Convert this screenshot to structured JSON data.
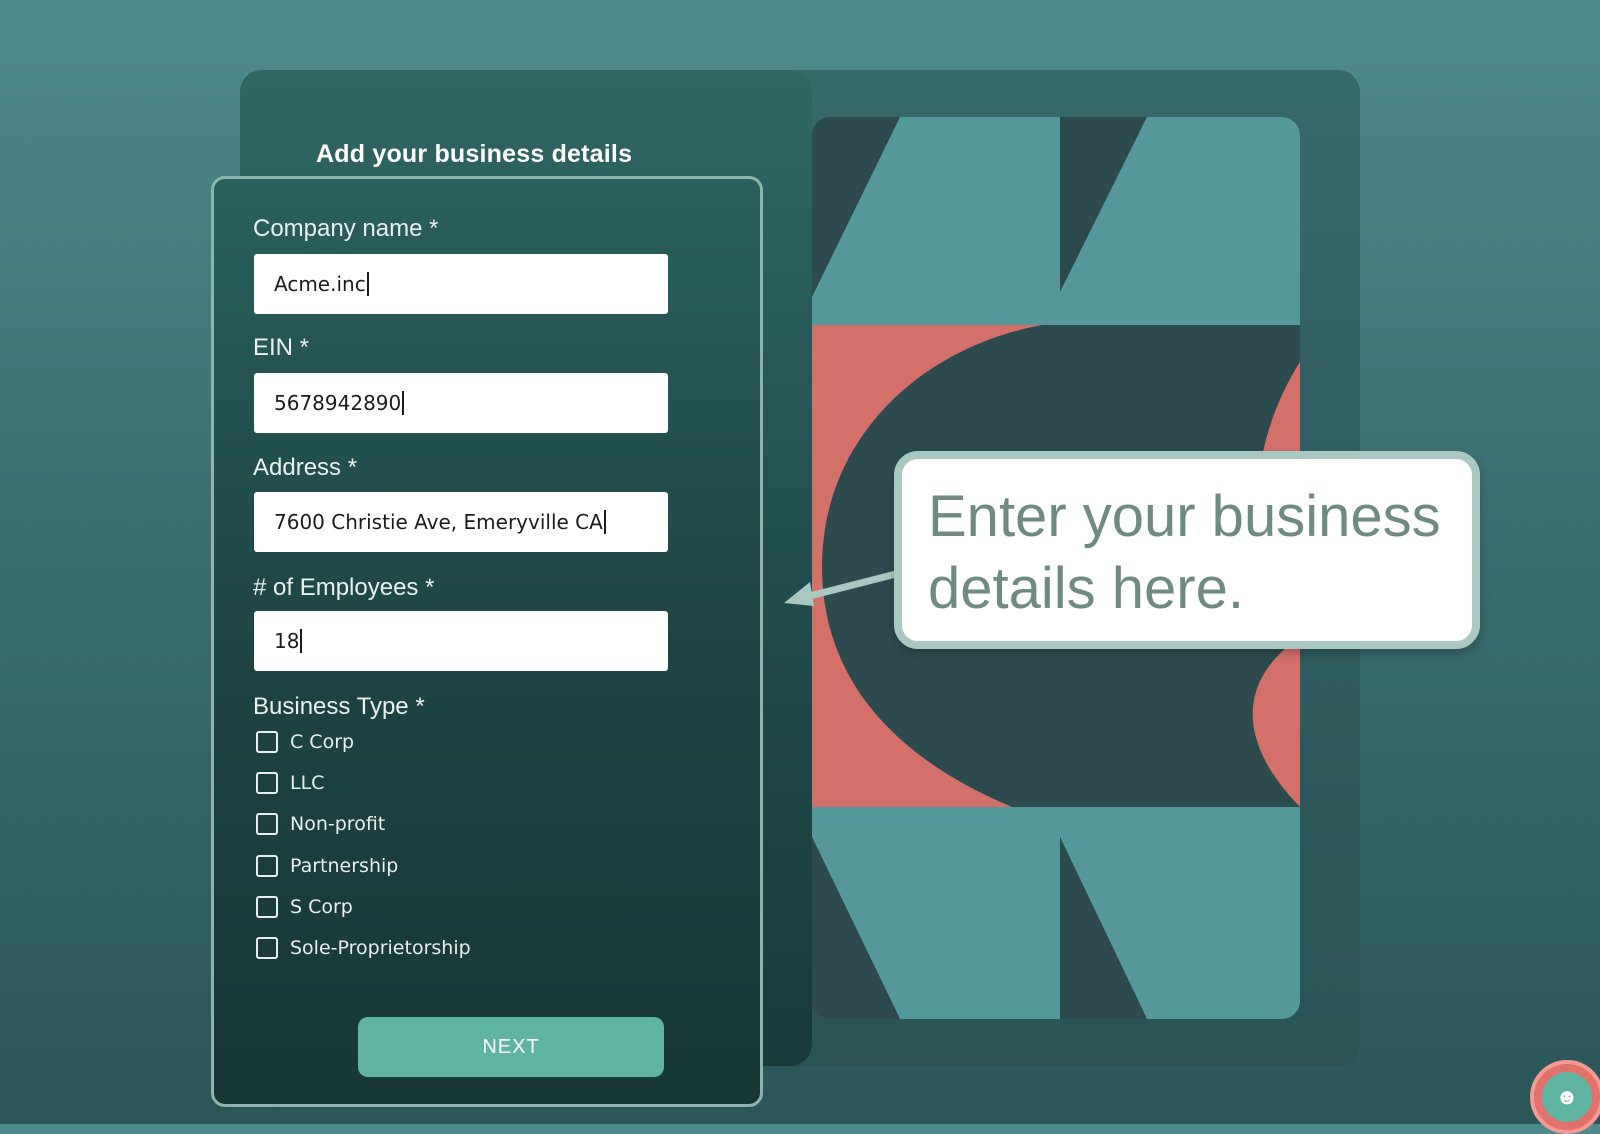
{
  "page": {
    "title": "Add your business details"
  },
  "form": {
    "company": {
      "label": "Company name *",
      "value": "Acme.inc"
    },
    "ein": {
      "label": "EIN *",
      "value": "5678942890"
    },
    "address": {
      "label": "Address *",
      "value": "7600 Christie Ave, Emeryville CA"
    },
    "employees": {
      "label": "# of Employees *",
      "value": "18"
    },
    "business_type": {
      "label": "Business Type *",
      "options": [
        "C Corp",
        "LLC",
        "Non-profit",
        "Partnership",
        "S Corp",
        "Sole-Proprietorship"
      ]
    },
    "next_label": "NEXT"
  },
  "callout": {
    "text": "Enter your business details here."
  },
  "colors": {
    "accent": "#5fb3a1",
    "art_teal": "#54989b",
    "art_coral": "#d4706a",
    "art_dark": "#2d4b4f",
    "callout_border": "#a9c8c1",
    "callout_text": "#6f8a83"
  },
  "icons": {
    "callout_pointer": "arrow-left-icon",
    "assistant": "chat-assistant-icon"
  }
}
